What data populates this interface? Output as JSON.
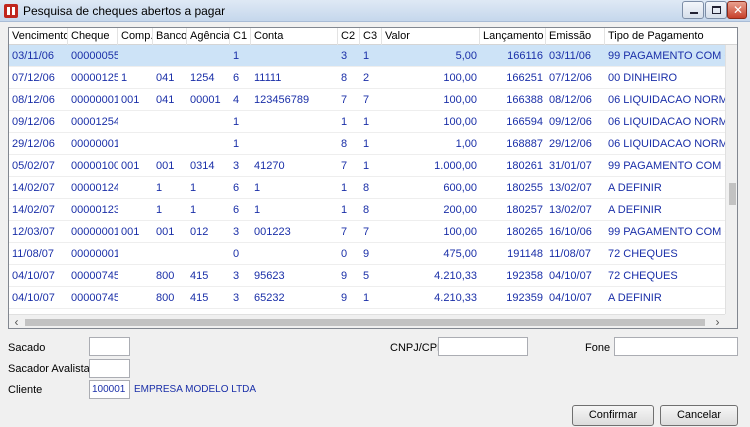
{
  "window": {
    "title": "Pesquisa de cheques abertos a pagar"
  },
  "columns": [
    {
      "key": "venc",
      "label": "Vencimento"
    },
    {
      "key": "cheque",
      "label": "Cheque"
    },
    {
      "key": "comp",
      "label": "Comp."
    },
    {
      "key": "banco",
      "label": "Banco"
    },
    {
      "key": "agencia",
      "label": "Agência"
    },
    {
      "key": "c1",
      "label": "C1"
    },
    {
      "key": "conta",
      "label": "Conta"
    },
    {
      "key": "c2",
      "label": "C2"
    },
    {
      "key": "c3",
      "label": "C3"
    },
    {
      "key": "valor",
      "label": "Valor"
    },
    {
      "key": "lanc",
      "label": "Lançamento"
    },
    {
      "key": "emissao",
      "label": "Emissão"
    },
    {
      "key": "tipo",
      "label": "Tipo de Pagamento"
    }
  ],
  "rows": [
    {
      "venc": "03/11/06",
      "cheque": "00000055",
      "comp": "",
      "banco": "",
      "agencia": "",
      "c1": "1",
      "conta": "",
      "c2": "3",
      "c3": "1",
      "valor": "5,00",
      "lanc": "166116",
      "emissao": "03/11/06",
      "tipo": "99 PAGAMENTO COM CHEQUE",
      "selected": true
    },
    {
      "venc": "07/12/06",
      "cheque": "00000125",
      "comp": "1",
      "banco": "041",
      "agencia": "1254",
      "c1": "6",
      "conta": "11111",
      "c2": "8",
      "c3": "2",
      "valor": "100,00",
      "lanc": "166251",
      "emissao": "07/12/06",
      "tipo": "00 DINHEIRO"
    },
    {
      "venc": "08/12/06",
      "cheque": "00000001",
      "comp": "001",
      "banco": "041",
      "agencia": "00001",
      "c1": "4",
      "conta": "123456789",
      "c2": "7",
      "c3": "7",
      "valor": "100,00",
      "lanc": "166388",
      "emissao": "08/12/06",
      "tipo": "06 LIQUIDACAO NORMAL"
    },
    {
      "venc": "09/12/06",
      "cheque": "00001254",
      "comp": "",
      "banco": "",
      "agencia": "",
      "c1": "1",
      "conta": "",
      "c2": "1",
      "c3": "1",
      "valor": "100,00",
      "lanc": "166594",
      "emissao": "09/12/06",
      "tipo": "06 LIQUIDACAO NORMAL"
    },
    {
      "venc": "29/12/06",
      "cheque": "00000001",
      "comp": "",
      "banco": "",
      "agencia": "",
      "c1": "1",
      "conta": "",
      "c2": "8",
      "c3": "1",
      "valor": "1,00",
      "lanc": "168887",
      "emissao": "29/12/06",
      "tipo": "06 LIQUIDACAO NORMAL"
    },
    {
      "venc": "05/02/07",
      "cheque": "00000100",
      "comp": "001",
      "banco": "001",
      "agencia": "0314",
      "c1": "3",
      "conta": "41270",
      "c2": "7",
      "c3": "1",
      "valor": "1.000,00",
      "lanc": "180261",
      "emissao": "31/01/07",
      "tipo": "99 PAGAMENTO COM CHEQUE"
    },
    {
      "venc": "14/02/07",
      "cheque": "00000124",
      "comp": "",
      "banco": "1",
      "agencia": "1",
      "c1": "6",
      "conta": "1",
      "c2": "1",
      "c3": "8",
      "valor": "600,00",
      "lanc": "180255",
      "emissao": "13/02/07",
      "tipo": "A DEFINIR"
    },
    {
      "venc": "14/02/07",
      "cheque": "00000123",
      "comp": "",
      "banco": "1",
      "agencia": "1",
      "c1": "6",
      "conta": "1",
      "c2": "1",
      "c3": "8",
      "valor": "200,00",
      "lanc": "180257",
      "emissao": "13/02/07",
      "tipo": "A DEFINIR"
    },
    {
      "venc": "12/03/07",
      "cheque": "00000001",
      "comp": "001",
      "banco": "001",
      "agencia": "012",
      "c1": "3",
      "conta": "001223",
      "c2": "7",
      "c3": "7",
      "valor": "100,00",
      "lanc": "180265",
      "emissao": "16/10/06",
      "tipo": "99 PAGAMENTO COM CHEQUE"
    },
    {
      "venc": "11/08/07",
      "cheque": "00000001",
      "comp": "",
      "banco": "",
      "agencia": "",
      "c1": "0",
      "conta": "",
      "c2": "0",
      "c3": "9",
      "valor": "475,00",
      "lanc": "191148",
      "emissao": "11/08/07",
      "tipo": "72 CHEQUES"
    },
    {
      "venc": "04/10/07",
      "cheque": "00000745",
      "comp": "",
      "banco": "800",
      "agencia": "415",
      "c1": "3",
      "conta": "95623",
      "c2": "9",
      "c3": "5",
      "valor": "4.210,33",
      "lanc": "192358",
      "emissao": "04/10/07",
      "tipo": "72 CHEQUES"
    },
    {
      "venc": "04/10/07",
      "cheque": "00000745",
      "comp": "",
      "banco": "800",
      "agencia": "415",
      "c1": "3",
      "conta": "65232",
      "c2": "9",
      "c3": "1",
      "valor": "4.210,33",
      "lanc": "192359",
      "emissao": "04/10/07",
      "tipo": "A DEFINIR"
    }
  ],
  "form": {
    "sacado_label": "Sacado",
    "sacado_value": "",
    "sacador_label": "Sacador Avalista",
    "sacador_value": "",
    "cliente_label": "Cliente",
    "cliente_code": "100001",
    "cliente_name": "EMPRESA MODELO LTDA",
    "cnpj_label": "CNPJ/CPF",
    "cnpj_value": "",
    "fone_label": "Fone",
    "fone_value": ""
  },
  "buttons": {
    "confirm": "Confirmar",
    "cancel": "Cancelar"
  }
}
